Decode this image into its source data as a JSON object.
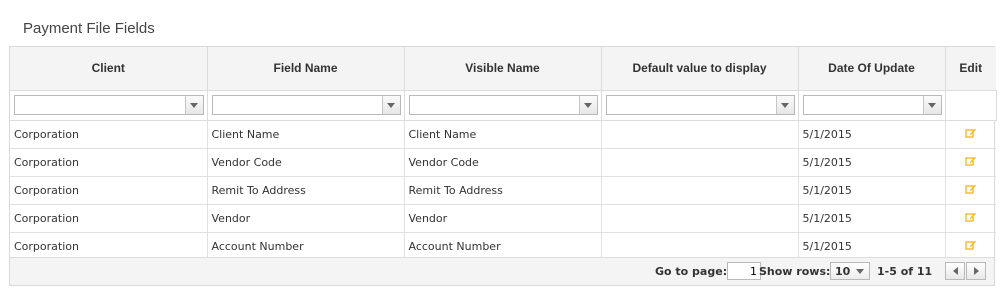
{
  "page_title": "Payment File Fields",
  "columns": [
    "Client",
    "Field Name",
    "Visible Name",
    "Default value to display",
    "Date Of Update",
    "Edit"
  ],
  "rows": [
    {
      "client": "Corporation",
      "field_name": "Client Name",
      "visible_name": "Client Name",
      "default_value": "",
      "date": "5/1/2015"
    },
    {
      "client": "Corporation",
      "field_name": "Vendor Code",
      "visible_name": "Vendor Code",
      "default_value": "",
      "date": "5/1/2015"
    },
    {
      "client": "Corporation",
      "field_name": "Remit To Address",
      "visible_name": "Remit To Address",
      "default_value": "",
      "date": "5/1/2015"
    },
    {
      "client": "Corporation",
      "field_name": "Vendor",
      "visible_name": "Vendor",
      "default_value": "",
      "date": "5/1/2015"
    },
    {
      "client": "Corporation",
      "field_name": "Account Number",
      "visible_name": "Account Number",
      "default_value": "",
      "date": "5/1/2015"
    }
  ],
  "pager": {
    "go_to_page_label": "Go to page:",
    "current_page": "1",
    "show_rows_label": "Show rows:",
    "rows_per_page": "10",
    "range_text": "1-5 of 11"
  },
  "colors": {
    "edit_icon": "#f0b31b",
    "header_bg": "#f4f4f4",
    "border": "#dcdcdc"
  },
  "icons": {
    "edit": "edit-icon",
    "dropdown": "chevron-down-icon",
    "prev": "chevron-left-icon",
    "next": "chevron-right-icon"
  }
}
